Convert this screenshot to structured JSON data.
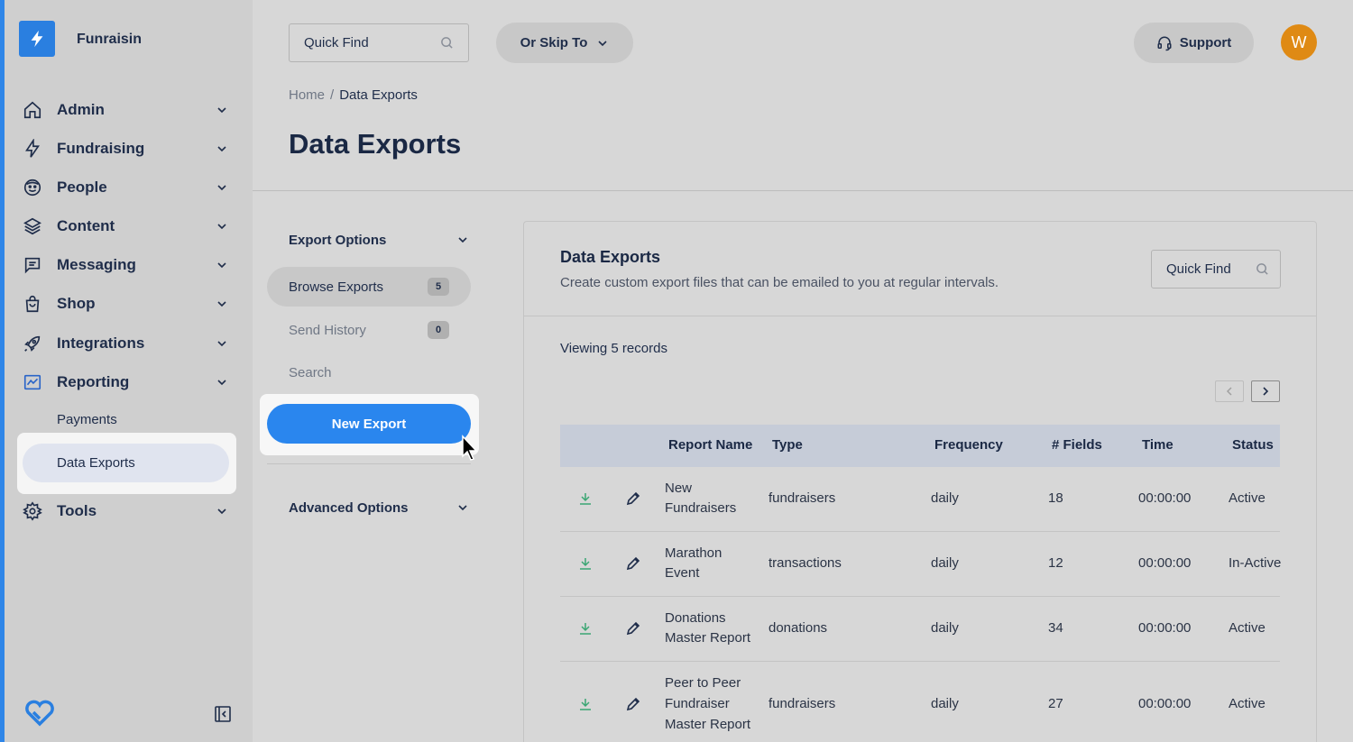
{
  "sidebar": {
    "brand": "Funraisin",
    "nav": [
      {
        "label": "Admin",
        "icon": "home-icon"
      },
      {
        "label": "Fundraising",
        "icon": "bolt-icon"
      },
      {
        "label": "People",
        "icon": "face-icon"
      },
      {
        "label": "Content",
        "icon": "layers-icon"
      },
      {
        "label": "Messaging",
        "icon": "message-icon"
      },
      {
        "label": "Shop",
        "icon": "shopping-bag-icon"
      },
      {
        "label": "Integrations",
        "icon": "rocket-icon"
      },
      {
        "label": "Reporting",
        "icon": "chart-icon"
      }
    ],
    "reporting_sub": [
      "Payments",
      "Data Exports"
    ],
    "tools_label": "Tools"
  },
  "topbar": {
    "search_placeholder": "Quick Find",
    "skip_label": "Or Skip To",
    "support_label": "Support",
    "avatar_initial": "W"
  },
  "breadcrumb": {
    "home": "Home",
    "separator": "/",
    "current": "Data Exports"
  },
  "page_title": "Data Exports",
  "options": {
    "export_options_label": "Export Options",
    "browse_label": "Browse Exports",
    "browse_count": "5",
    "history_label": "Send History",
    "history_count": "0",
    "search_label": "Search",
    "new_export_label": "New Export",
    "advanced_label": "Advanced Options"
  },
  "card": {
    "title": "Data Exports",
    "subtitle": "Create custom export files that can be emailed to you at regular intervals.",
    "search_placeholder": "Quick Find",
    "viewing": "Viewing 5 records"
  },
  "table": {
    "headers": {
      "name": "Report Name",
      "type": "Type",
      "frequency": "Frequency",
      "fields": "# Fields",
      "time": "Time",
      "status": "Status"
    },
    "rows": [
      {
        "name1": "New",
        "name2": "Fundraisers",
        "name3": "",
        "type": "fundraisers",
        "frequency": "daily",
        "fields": "18",
        "time": "00:00:00",
        "status": "Active"
      },
      {
        "name1": "Marathon",
        "name2": "Event",
        "name3": "",
        "type": "transactions",
        "frequency": "daily",
        "fields": "12",
        "time": "00:00:00",
        "status": "In-Active"
      },
      {
        "name1": "Donations",
        "name2": "Master Report",
        "name3": "",
        "type": "donations",
        "frequency": "daily",
        "fields": "34",
        "time": "00:00:00",
        "status": "Active"
      },
      {
        "name1": "Peer to Peer",
        "name2": "Fundraiser",
        "name3": "Master Report",
        "type": "fundraisers",
        "frequency": "daily",
        "fields": "27",
        "time": "00:00:00",
        "status": "Active"
      }
    ]
  },
  "colors": {
    "accent": "#2a86ee",
    "avatar": "#df8a14",
    "download": "#3aa673"
  }
}
